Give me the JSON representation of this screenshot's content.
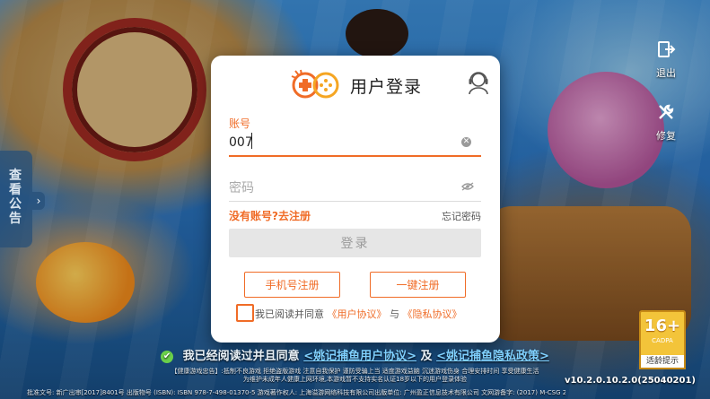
{
  "side_panel": {
    "label": "查看公告",
    "arrow": "›"
  },
  "right_controls": {
    "exit_label": "退出",
    "repair_label": "修复"
  },
  "dialog": {
    "title": "用户登录",
    "account_label": "账号",
    "account_value": "007",
    "password_placeholder": "密码",
    "register_link": "没有账号?去注册",
    "forgot_link": "忘记密码",
    "login_button": "登录",
    "phone_register_button": "手机号注册",
    "quick_register_button": "一键注册",
    "agree_prefix": "我已阅读并同意",
    "user_agreement": "《用户协议》",
    "agree_and": "与",
    "privacy_agreement": "《隐私协议》"
  },
  "bottom": {
    "agree_text": "我已经阅读过并且同意",
    "agree_link1": "<姚记捕鱼用户协议>",
    "agree_and": "及",
    "agree_link2": "<姚记捕鱼隐私政策>",
    "health_notice": "【健康游戏忠告】:抵制不良游戏 拒绝盗版游戏 注意自我保护 谨防受骗上当 适度游戏益脑 沉迷游戏伤身 合理安排时间 享受健康生活",
    "minor_notice": "为维护未成年人健康上网环境,本游戏暂不支持实名认证18岁以下的用户登录体验",
    "publisher_line": "批准文号: 新广出审[2017]8401号 出版物号 (ISBN): ISBN 978-7-498-01370-5 游戏著作权人: 上海溢游网络科技有限公司出版单位: 广州盈正信息技术有限公司 文网游备字: (2017) M-CSG 2532 号",
    "version": "v10.2.0.10.2.0(25040201)"
  },
  "age_rating": {
    "age": "16+",
    "org": "CADPA",
    "tip": "适龄提示"
  },
  "colors": {
    "accent": "#f06c27",
    "login_disabled_bg": "#e6e6e6",
    "age_badge": "#f3c43a"
  },
  "icons": {
    "logo": "gamepad-logo-icon",
    "service": "customer-service-icon",
    "clear": "clear-input-icon",
    "eye": "eye-hidden-icon",
    "exit": "exit-icon",
    "repair": "wrench-icon"
  }
}
